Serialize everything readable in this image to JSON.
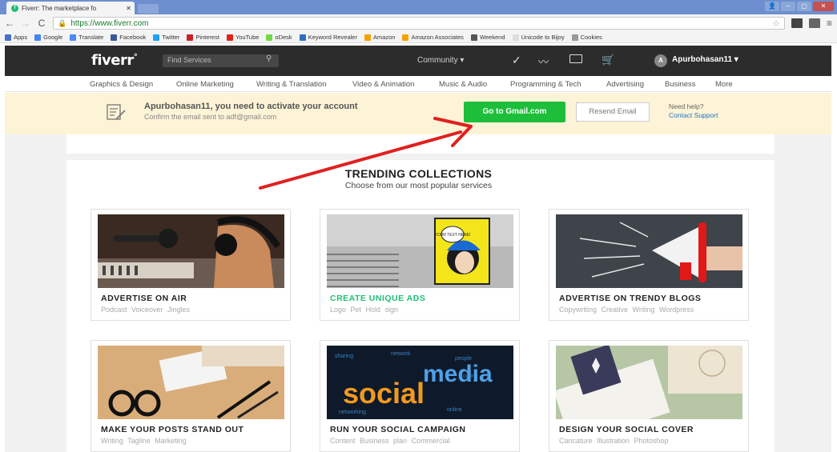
{
  "browser": {
    "tab_title": "Fiverr: The marketplace fo",
    "tab_favicon": "fiverr-icon",
    "url": "https://www.fiverr.com",
    "bookmarks": [
      {
        "label": "Apps",
        "color": "#4a6fd1"
      },
      {
        "label": "Google",
        "color": "#4285f4"
      },
      {
        "label": "Translate",
        "color": "#4a8af4"
      },
      {
        "label": "Facebook",
        "color": "#3b5998"
      },
      {
        "label": "Twitter",
        "color": "#1da1f2"
      },
      {
        "label": "Pinterest",
        "color": "#cb2027"
      },
      {
        "label": "YouTube",
        "color": "#e62117"
      },
      {
        "label": "oDesk",
        "color": "#6fda44"
      },
      {
        "label": "Keyword Revealer",
        "color": "#2e6fc4"
      },
      {
        "label": "Amazon",
        "color": "#f3a200"
      },
      {
        "label": "Amazon Associates",
        "color": "#f3a200"
      },
      {
        "label": "Weekend",
        "color": "#555555"
      },
      {
        "label": "Unicode to Bijoy",
        "color": "#dddddd"
      },
      {
        "label": "Cookies",
        "color": "#999999"
      }
    ]
  },
  "header": {
    "logo": "fiverr",
    "logo_mark": "°",
    "search_placeholder": "Find Services",
    "community": "Community ▾",
    "avatar_letter": "A",
    "username": "Apurbohasan11 ▾"
  },
  "categories": [
    "Graphics & Design",
    "Online Marketing",
    "Writing & Translation",
    "Video & Animation",
    "Music & Audio",
    "Programming & Tech",
    "Advertising",
    "Business",
    "More"
  ],
  "banner": {
    "title": "Apurbohasan11, you need to activate your account",
    "subtitle": "Confirm the email sent to adf@gmail.com",
    "primary_button": "Go to Gmail.com",
    "secondary_button": "Resend Email",
    "help_title": "Need help?",
    "help_link": "Contact Support"
  },
  "trending": {
    "title": "TRENDING COLLECTIONS",
    "subtitle": "Choose from our most popular services",
    "cards": [
      {
        "title": "ADVERTISE ON AIR",
        "tags": "Podcast  Voiceover  Jingles",
        "highlight": false
      },
      {
        "title": "CREATE UNIQUE ADS",
        "tags": "Logo  Pet  Hold sign",
        "highlight": true,
        "img_text": "YOUR TEXT HERE!"
      },
      {
        "title": "ADVERTISE ON TRENDY BLOGS",
        "tags": "Copywriting  Creative Writing  Wordpress",
        "highlight": false
      },
      {
        "title": "MAKE YOUR POSTS STAND OUT",
        "tags": "Writing  Tagline  Marketing",
        "highlight": false
      },
      {
        "title": "RUN YOUR SOCIAL CAMPAIGN",
        "tags": "Content  Business plan  Commercial",
        "highlight": false,
        "img_text_a": "social",
        "img_text_b": "media"
      },
      {
        "title": "DESIGN YOUR SOCIAL COVER",
        "tags": "Caricature  Illustration  Photoshop",
        "highlight": false
      }
    ]
  },
  "colors": {
    "brand_green": "#1dbf73",
    "button_green": "#1dbf3a",
    "header_dark": "#2c2c2c",
    "banner_bg": "#fdf3d6",
    "arrow_red": "#e02020"
  }
}
